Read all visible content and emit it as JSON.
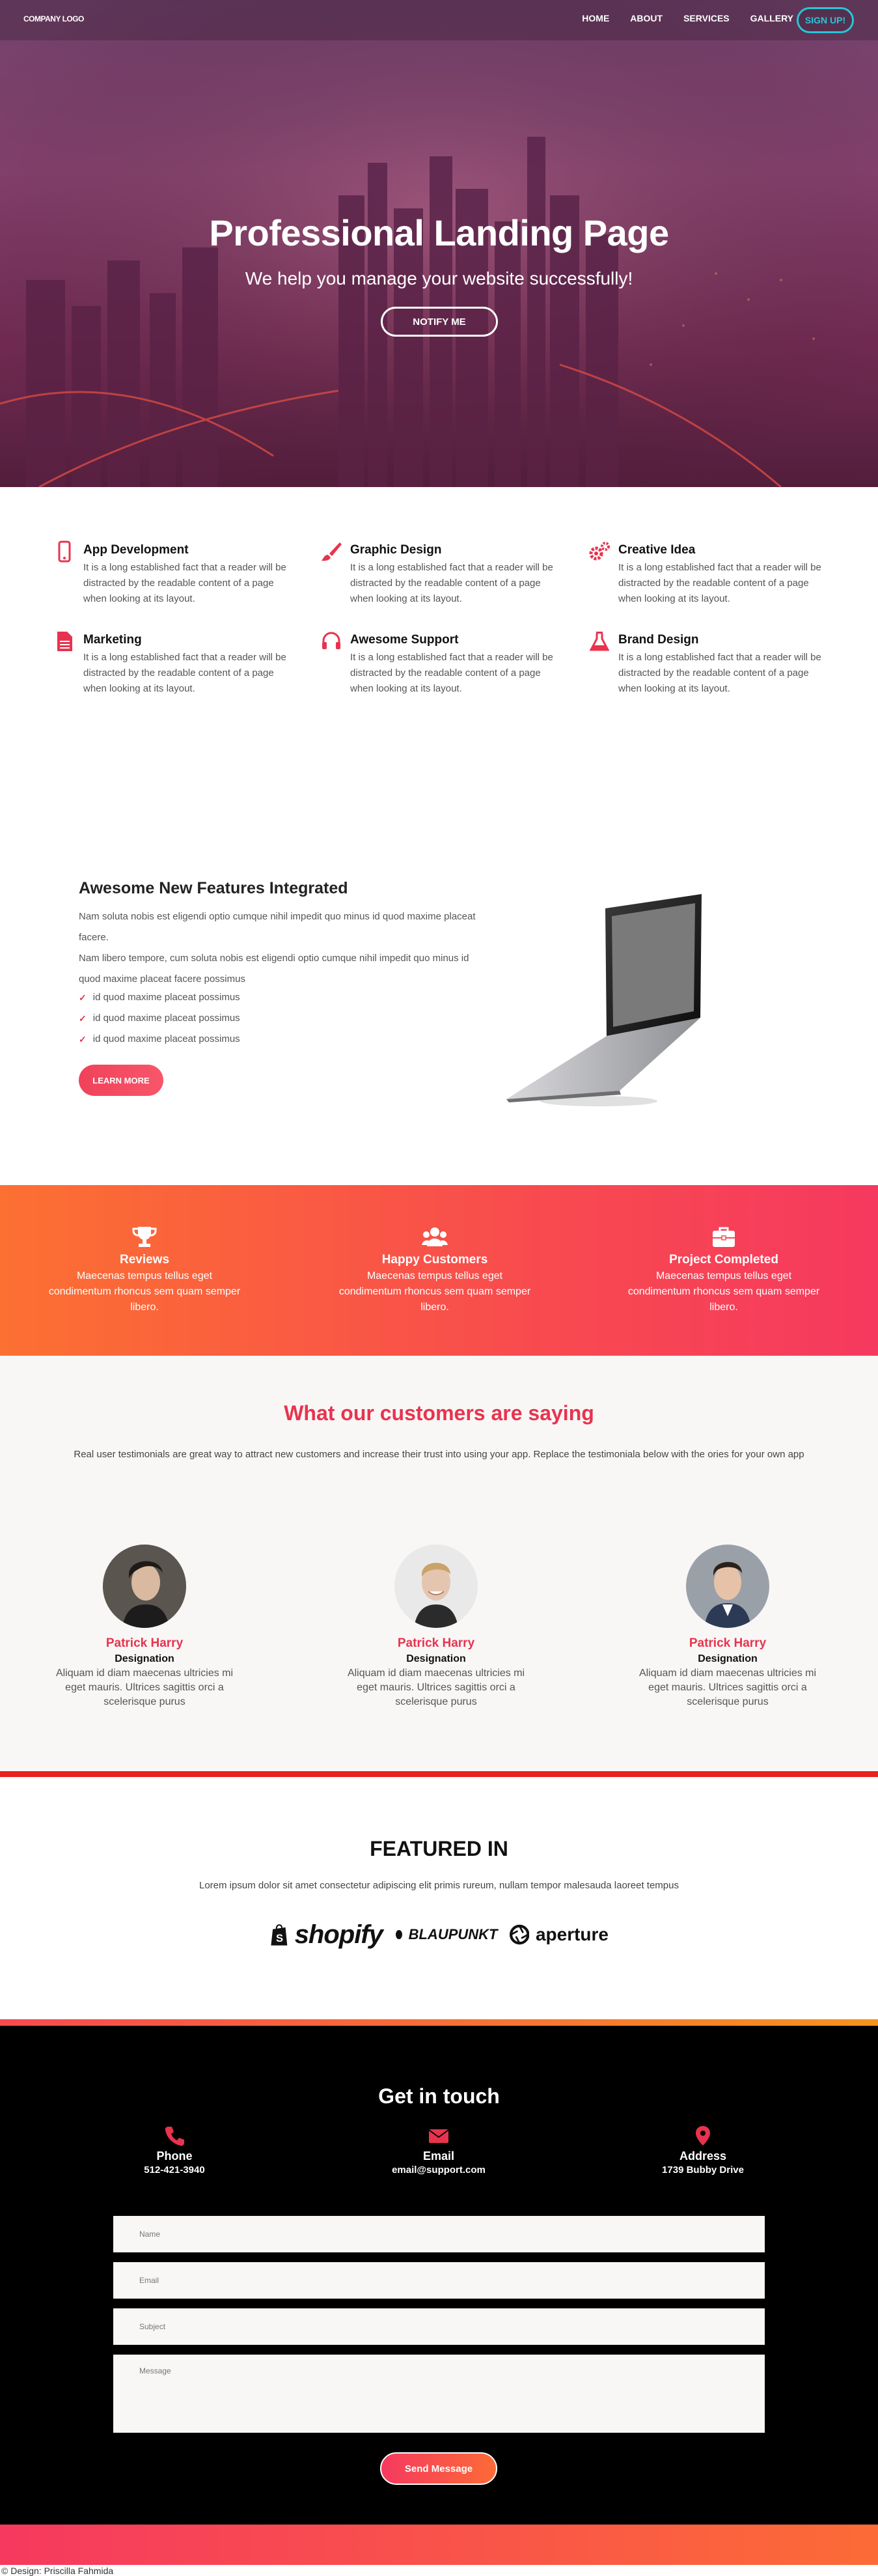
{
  "nav": {
    "logo": "COMPANY LOGO",
    "links": [
      "HOME",
      "ABOUT",
      "SERVICES",
      "GALLERY"
    ],
    "signup": "SIGN UP!"
  },
  "hero": {
    "title": "Professional Landing Page",
    "subtitle": "We help you manage your website successfully!",
    "button": "NOTIFY ME"
  },
  "services": [
    {
      "icon": "phone-icon",
      "title": "App Development",
      "text": "It is a long established fact that a reader will be distracted by the readable content of a page when looking at its layout."
    },
    {
      "icon": "brush-icon",
      "title": "Graphic Design",
      "text": "It is a long established fact that a reader will be distracted by the readable content of a page when looking at its layout."
    },
    {
      "icon": "gears-icon",
      "title": "Creative Idea",
      "text": "It is a long established fact that a reader will be distracted by the readable content of a page when looking at its layout."
    },
    {
      "icon": "document-icon",
      "title": "Marketing",
      "text": "It is a long established fact that a reader will be distracted by the readable content of a page when looking at its layout."
    },
    {
      "icon": "headset-icon",
      "title": "Awesome Support",
      "text": "It is a long established fact that a reader will be distracted by the readable content of a page when looking at its layout."
    },
    {
      "icon": "flask-icon",
      "title": "Brand Design",
      "text": "It is a long established fact that a reader will be distracted by the readable content of a page when looking at its layout."
    }
  ],
  "features": {
    "title": "Awesome New Features Integrated",
    "paragraph1": "Nam soluta nobis est eligendi optio cumque nihil impedit quo minus id quod maxime placeat facere.",
    "paragraph2": "Nam libero tempore, cum soluta nobis est eligendi optio cumque nihil impedit quo minus id quod maxime placeat facere possimus",
    "list": [
      "id quod maxime placeat possimus",
      "id quod maxime placeat possimus",
      "id quod maxime placeat possimus"
    ],
    "button": "LEARN MORE"
  },
  "stats": [
    {
      "icon": "trophy-icon",
      "title": "Reviews",
      "text": "Maecenas tempus tellus eget condimentum rhoncus sem quam semper libero."
    },
    {
      "icon": "users-icon",
      "title": "Happy Customers",
      "text": "Maecenas tempus tellus eget condimentum rhoncus sem quam semper libero."
    },
    {
      "icon": "briefcase-icon",
      "title": "Project Completed",
      "text": "Maecenas tempus tellus eget condimentum rhoncus sem quam semper libero."
    }
  ],
  "testimonials": {
    "title": "What our customers are saying",
    "subtitle": "Real user testimonials are great way to attract new customers and increase their trust into using your app. Replace the testimoniala below with the ories for your own app",
    "cards": [
      {
        "name": "Patrick Harry",
        "role": "Designation",
        "text": "Aliquam id diam maecenas ultricies mi eget mauris. Ultrices sagittis orci a scelerisque purus"
      },
      {
        "name": "Patrick Harry",
        "role": "Designation",
        "text": "Aliquam id diam maecenas ultricies mi eget mauris. Ultrices sagittis orci a scelerisque purus"
      },
      {
        "name": "Patrick Harry",
        "role": "Designation",
        "text": "Aliquam id diam maecenas ultricies mi eget mauris. Ultrices sagittis orci a scelerisque purus"
      }
    ]
  },
  "featured": {
    "title": "FEATURED IN",
    "text": "Lorem ipsum dolor sit amet consectetur adipiscing elit primis rureum, nullam tempor malesauda laoreet tempus",
    "brands": [
      "shopify",
      "BLAUPUNKT",
      "aperture"
    ]
  },
  "contact": {
    "title": "Get in touch",
    "info": [
      {
        "icon": "phone-icon",
        "label": "Phone",
        "value": "512-421-3940"
      },
      {
        "icon": "envelope-icon",
        "label": "Email",
        "value": "email@support.com"
      },
      {
        "icon": "map-pin-icon",
        "label": "Address",
        "value": "1739 Bubby Drive"
      }
    ],
    "placeholders": {
      "name": "Name",
      "email": "Email",
      "subject": "Subject",
      "message": "Message"
    },
    "button": "Send Message"
  },
  "credit": "© Design: Priscilla Fahmida",
  "colors": {
    "accent": "#e8334f",
    "signup": "#29c5d6",
    "orange": "#fc7032",
    "pink": "#f6395f"
  }
}
